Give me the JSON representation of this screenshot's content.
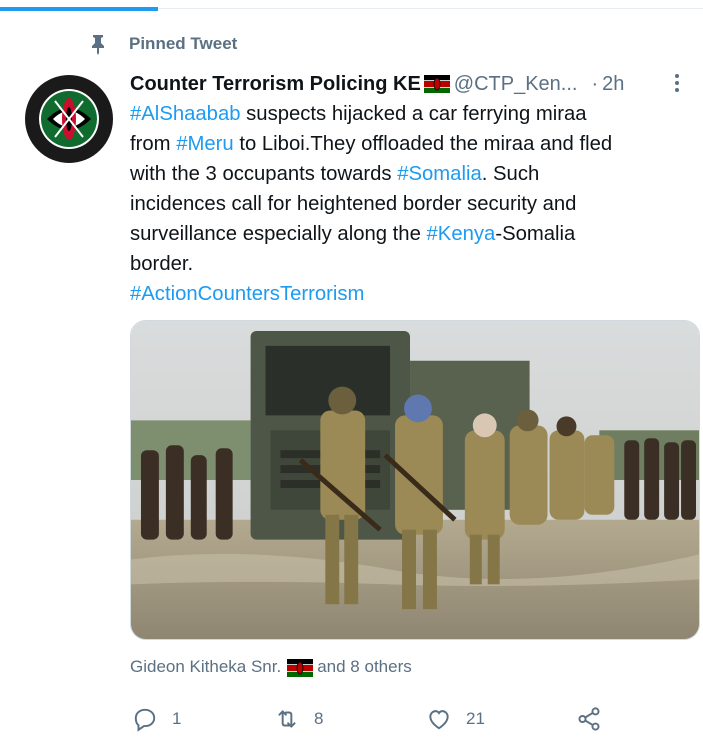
{
  "progress": {
    "fraction": 0.225,
    "color": "#1d9bf0"
  },
  "pinned": {
    "label": "Pinned Tweet",
    "icon": "pin-icon"
  },
  "tweet": {
    "display_name": "Counter Terrorism Policing KE",
    "handle": "@CTP_Ken...",
    "dot": "·",
    "time": "2h",
    "avatar_text_top": "COUNTER TERRORISM",
    "avatar_text_bottom": "POLICING",
    "lines": [
      [
        {
          "t": "#AlShaabab",
          "link": true
        },
        {
          "t": " suspects hijacked a car ferrying miraa",
          "link": false
        }
      ],
      [
        {
          "t": "from ",
          "link": false
        },
        {
          "t": "#Meru",
          "link": true
        },
        {
          "t": " to Liboi.They offloaded the miraa and fled",
          "link": false
        }
      ],
      [
        {
          "t": "with the 3 occupants towards ",
          "link": false
        },
        {
          "t": "#Somalia",
          "link": true
        },
        {
          "t": ". Such",
          "link": false
        }
      ],
      [
        {
          "t": "incidences call for heightened border security and",
          "link": false
        }
      ],
      [
        {
          "t": "surveillance especially along the ",
          "link": false
        },
        {
          "t": "#Kenya",
          "link": true
        },
        {
          "t": "-Somalia",
          "link": false
        }
      ],
      [
        {
          "t": "border.",
          "link": false
        }
      ],
      [
        {
          "t": "#ActionCountersTerrorism",
          "link": true
        }
      ]
    ]
  },
  "liked_by": {
    "name": "Gideon Kitheka Snr.",
    "others": "and 8 others"
  },
  "actions": {
    "reply_count": "1",
    "retweet_count": "8",
    "like_count": "21"
  },
  "colors": {
    "link": "#1d9bf0",
    "secondary": "#5b7083",
    "text": "#0f1419"
  }
}
